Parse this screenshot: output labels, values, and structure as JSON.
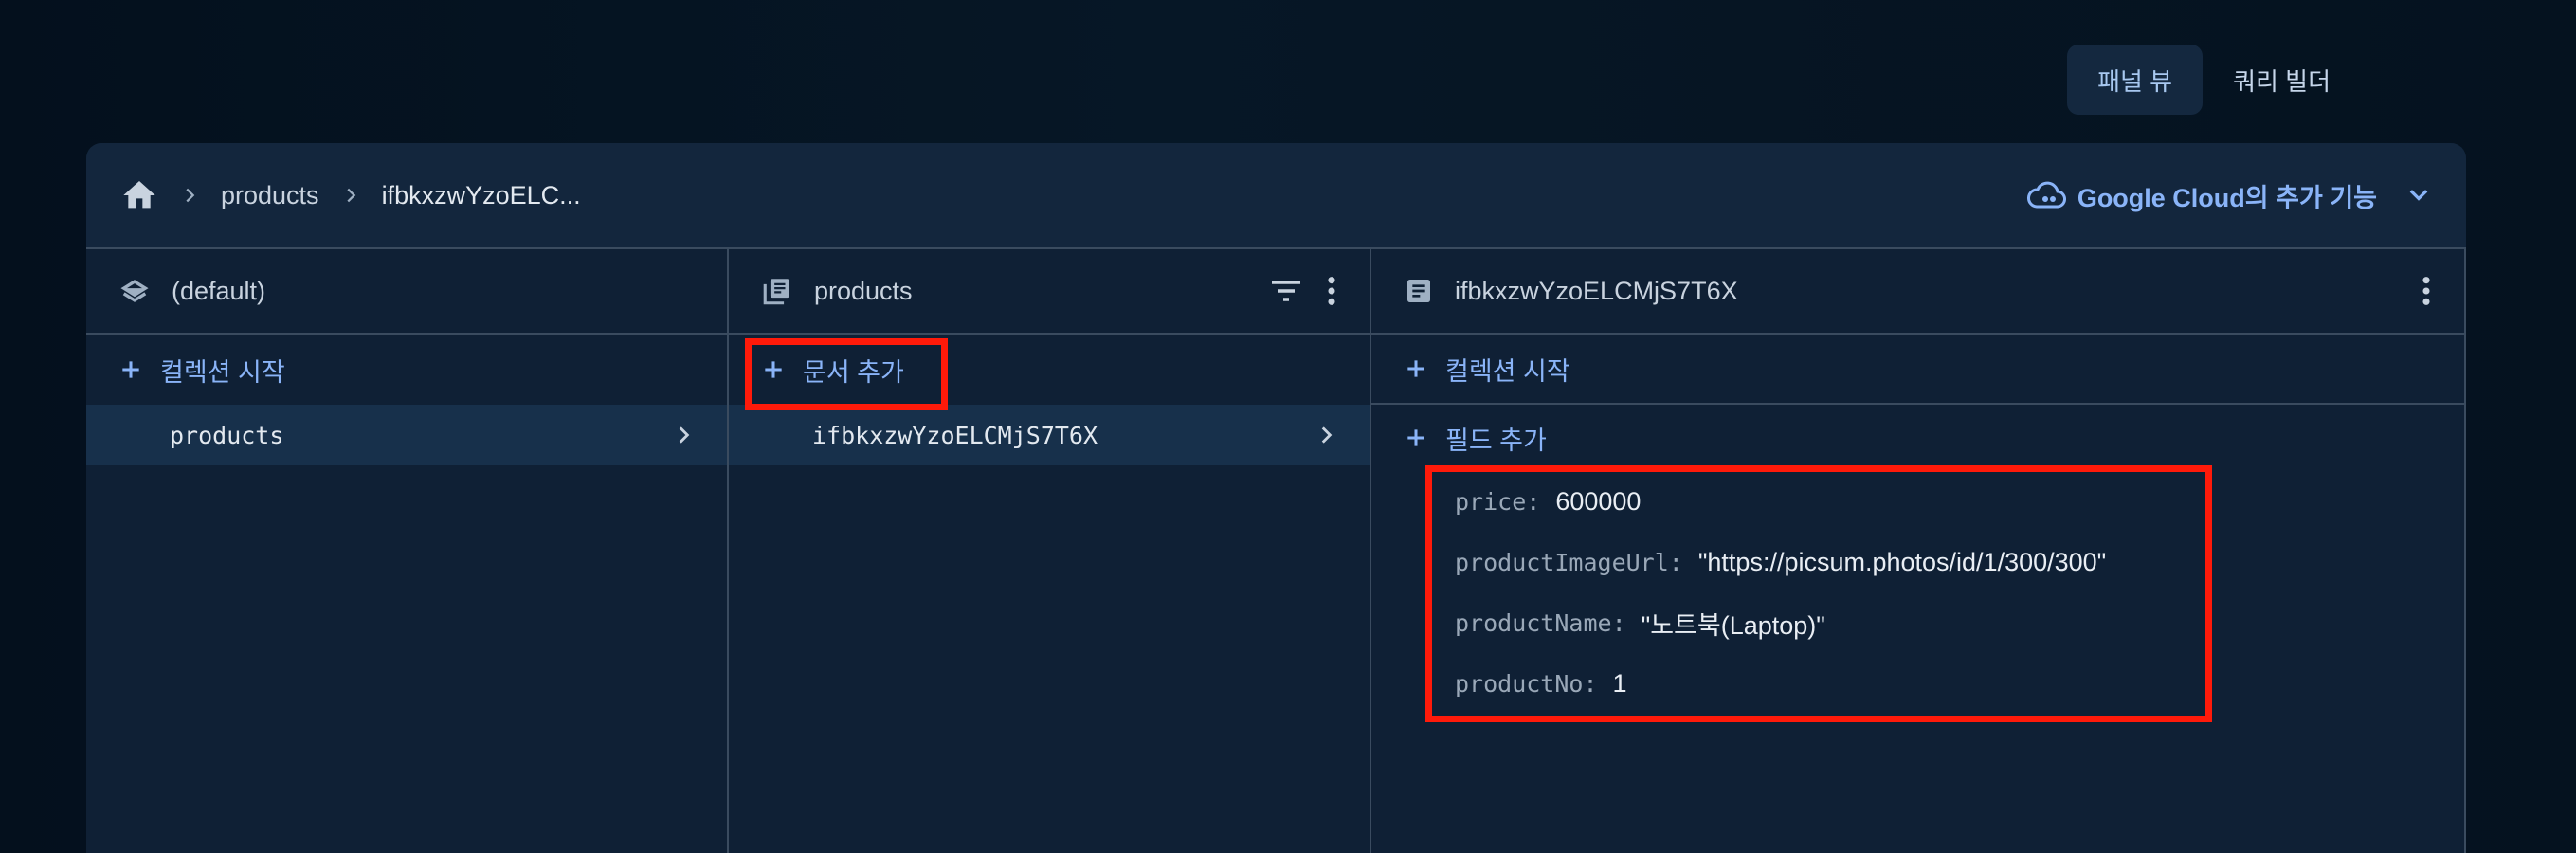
{
  "view_switch": {
    "panel_view": "패널 뷰",
    "query_builder": "쿼리 빌더"
  },
  "breadcrumb": {
    "items": [
      "products",
      "ifbkxzwYzoELC..."
    ]
  },
  "gcloud": {
    "brand": "Google Cloud",
    "suffix": "의 추가 기능"
  },
  "columns": {
    "database": {
      "title": "(default)",
      "start_collection": "컬렉션 시작",
      "items": [
        "products"
      ]
    },
    "collection": {
      "title": "products",
      "add_document": "문서 추가",
      "items": [
        "ifbkxzwYzoELCMjS7T6X"
      ]
    },
    "document": {
      "title": "ifbkxzwYzoELCMjS7T6X",
      "start_collection": "컬렉션 시작",
      "add_field": "필드 추가",
      "fields": [
        {
          "key": "price:",
          "value": "600000"
        },
        {
          "key": "productImageUrl:",
          "value": "\"https://picsum.photos/id/1/300/300\""
        },
        {
          "key": "productName:",
          "value": "\"노트북(Laptop)\""
        },
        {
          "key": "productNo:",
          "value": "1"
        }
      ]
    }
  },
  "icons": [
    "home-icon",
    "chevron-right-icon",
    "cloud-icon",
    "chevron-down-icon",
    "database-icon",
    "collection-icon",
    "filter-icon",
    "more-vert-icon",
    "document-icon",
    "plus-icon"
  ],
  "colors": {
    "accent": "#8ab4f8",
    "highlight": "#ff1a0a",
    "background": "#061525",
    "panel": "#0f2035"
  }
}
